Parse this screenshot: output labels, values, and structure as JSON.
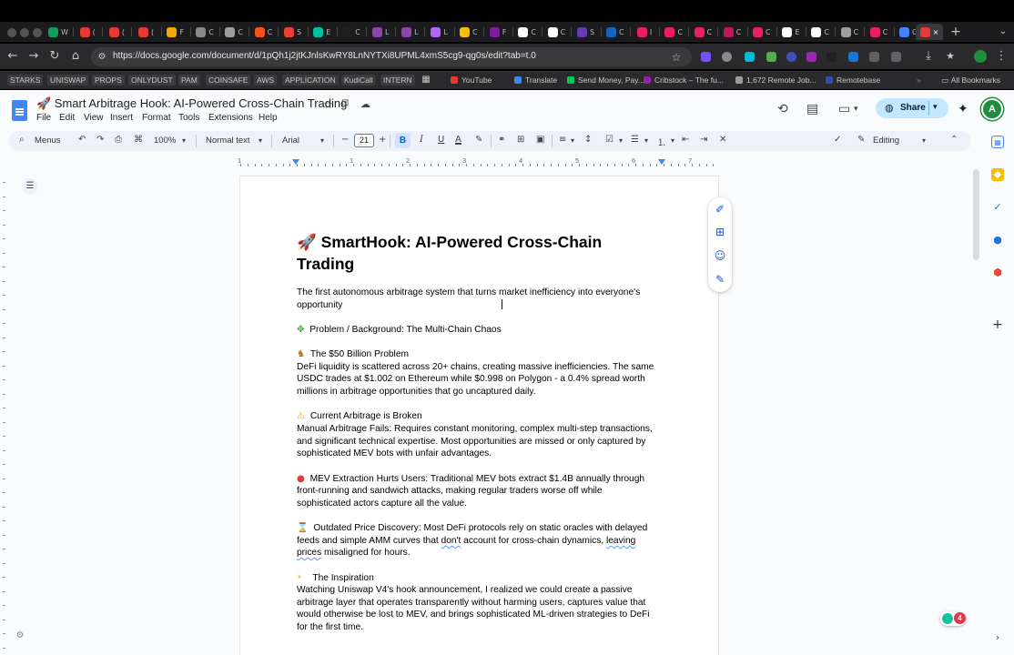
{
  "browser": {
    "url": "https://docs.google.com/document/d/1pQh1j2jtKJnlsKwRY8LnNYTXi8UPML4xmS5cg9-qg0s/edit?tab=t.0",
    "tabs": [
      {
        "c": "#0f9d58",
        "t": "W"
      },
      {
        "c": "#e53935",
        "t": "("
      },
      {
        "c": "#e53935",
        "t": "("
      },
      {
        "c": "#e53935",
        "t": "("
      },
      {
        "c": "#f2a900",
        "t": "F"
      },
      {
        "c": "#888888",
        "t": "C"
      },
      {
        "c": "#9e9e9e",
        "t": "C"
      },
      {
        "c": "#f4511e",
        "t": "C"
      },
      {
        "c": "#ea4335",
        "t": "S"
      },
      {
        "c": "#00bfa5",
        "t": "E"
      },
      {
        "c": "#212121",
        "t": "C"
      },
      {
        "c": "#8e44ad",
        "t": "L"
      },
      {
        "c": "#8e44ad",
        "t": "L"
      },
      {
        "c": "#b266ff",
        "t": "L"
      },
      {
        "c": "#fbbc04",
        "t": "C"
      },
      {
        "c": "#7b1fa2",
        "t": "F"
      },
      {
        "c": "#ffffff",
        "t": "C"
      },
      {
        "c": "#ffffff",
        "t": "C"
      },
      {
        "c": "#673ab7",
        "t": "S"
      },
      {
        "c": "#1565c0",
        "t": "C"
      },
      {
        "c": "#e91e63",
        "t": "I"
      },
      {
        "c": "#e91e63",
        "t": "C"
      },
      {
        "c": "#e91e63",
        "t": "C"
      },
      {
        "c": "#c2185b",
        "t": "C"
      },
      {
        "c": "#e91e63",
        "t": "C"
      },
      {
        "c": "#ffffff",
        "t": "E"
      },
      {
        "c": "#ffffff",
        "t": "C"
      },
      {
        "c": "#9e9e9e",
        "t": "C"
      },
      {
        "c": "#e91e63",
        "t": "C"
      },
      {
        "c": "#4285f4",
        "t": "C"
      }
    ]
  },
  "bookmarks": {
    "items": [
      "STARKS",
      "UNISWAP",
      "PROPS",
      "ONLYDUST",
      "PAM",
      "COINSAFE",
      "AWS",
      "APPLICATION",
      "KudiCall",
      "INTERN"
    ],
    "sites": [
      "YouTube",
      "Translate",
      "Send Money, Pay...",
      "Cribstock – The fu...",
      "1,672 Remote Job...",
      "Remotebase"
    ],
    "all": "All Bookmarks"
  },
  "docs": {
    "title": "🚀 Smart Arbitrage Hook: AI-Powered Cross-Chain Trading",
    "menus": [
      "File",
      "Edit",
      "View",
      "Insert",
      "Format",
      "Tools",
      "Extensions",
      "Help"
    ],
    "share_label": "Share",
    "avatar_letter": "A"
  },
  "toolbar": {
    "menus_label": "Menus",
    "zoom": "100%",
    "style": "Normal text",
    "font": "Arial",
    "font_size": "21",
    "mode": "Editing",
    "bold": "B",
    "italic": "I",
    "underline": "U",
    "text_color": "A"
  },
  "ruler_numbers": [
    "1",
    "1",
    "2",
    "3",
    "4",
    "5",
    "6",
    "7"
  ],
  "document": {
    "title_line1": "🚀 SmartHook: AI-Powered Cross-Chain",
    "title_line2": "Trading",
    "subtitle_1": "The first autonomous arbitrage system that turns market inefficiency into everyone's",
    "subtitle_2": "opportunity",
    "problem_heading": "Problem / Background: The Multi-Chain Chaos",
    "s1_heading": "The $50 Billion Problem",
    "s1_l1": "DeFi liquidity is scattered across 20+ chains, creating massive inefficiencies. The same",
    "s1_l2": "USDC trades at $1.002 on Ethereum while $0.998 on Polygon - a 0.4% spread worth",
    "s1_l3": "millions in arbitrage opportunities that go uncaptured daily.",
    "s2_heading": "Current Arbitrage is Broken",
    "s2_l1": "Manual Arbitrage Fails: Requires constant monitoring, complex multi-step transactions,",
    "s2_l2": "and significant technical expertise. Most opportunities are missed or only captured by",
    "s2_l3": "sophisticated MEV bots with unfair advantages.",
    "s3_l1": "MEV Extraction Hurts Users: Traditional MEV bots extract $1.4B annually through",
    "s3_l2": "front-running and sandwich attacks, making regular traders worse off while",
    "s3_l3": "sophisticated actors capture all the value.",
    "s4_l1": "Outdated Price Discovery: Most DeFi protocols rely on static oracles with delayed",
    "s4_l2a": "feeds and simple AMM curves that ",
    "s4_l2b": "don't",
    "s4_l2c": " account for cross-chain dynamics, ",
    "s4_l2d": "leaving",
    "s4_l3a": "prices",
    "s4_l3b": " misaligned for hours.",
    "s5_heading": "The Inspiration",
    "s5_l1": "Watching Uniswap V4's hook announcement, I realized we could create a passive",
    "s5_l2": "arbitrage layer that operates transparently without harming users, captures value that",
    "s5_l3": "would otherwise be lost to MEV, and brings sophisticated ML-driven strategies to DeFi",
    "s5_l4": "for the first time."
  },
  "grammarly_count": "4",
  "colors": {
    "docs_blue": "#4285f4",
    "share_bg": "#c2e7ff",
    "toolbar_bg": "#edf2fa",
    "accent": "#0b57d0"
  }
}
